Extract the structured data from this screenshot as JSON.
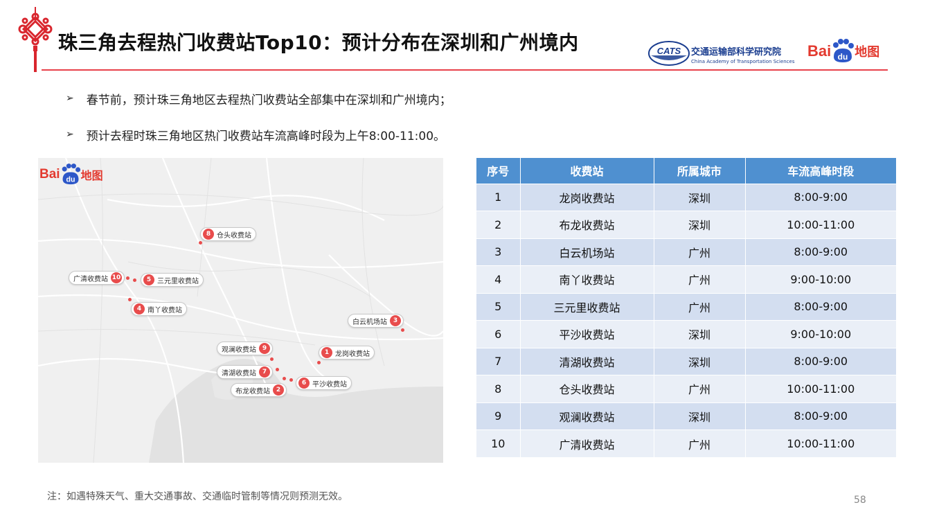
{
  "header": {
    "title": "珠三角去程热门收费站Top10：预计分布在深圳和广州境内",
    "cats_logo_text": "CATS",
    "cats_name_cn": "交通运输部科学研究院",
    "cats_name_en": "China Academy of Transportation Sciences",
    "baidu_bai": "Bai",
    "baidu_du": "du",
    "baidu_ditu": "地图"
  },
  "colors": {
    "accent_red": "#e8414b",
    "table_header": "#4f90d0",
    "row_dark": "#d3def0",
    "row_light": "#eaeff7",
    "marker_red": "#e84c4c"
  },
  "bullets": [
    {
      "icon": "arrow-bullet-icon",
      "text": "春节前，预计珠三角地区去程热门收费站全部集中在深圳和广州境内；"
    },
    {
      "icon": "arrow-bullet-icon",
      "text": "预计去程时珠三角地区热门收费站车流高峰时段为上午8:00-11:00。"
    }
  ],
  "map": {
    "baidu_bai": "Bai",
    "baidu_du": "du",
    "baidu_ditu": "地图",
    "markers": [
      {
        "rank": "8",
        "name": "仓头收费站"
      },
      {
        "rank": "10",
        "name": "广清收费站"
      },
      {
        "rank": "5",
        "name": "三元里收费站"
      },
      {
        "rank": "4",
        "name": "南丫收费站"
      },
      {
        "rank": "3",
        "name": "白云机场站"
      },
      {
        "rank": "9",
        "name": "观澜收费站"
      },
      {
        "rank": "1",
        "name": "龙岗收费站"
      },
      {
        "rank": "7",
        "name": "清湖收费站"
      },
      {
        "rank": "6",
        "name": "平沙收费站"
      },
      {
        "rank": "2",
        "name": "布龙收费站"
      }
    ]
  },
  "table": {
    "headers": [
      "序号",
      "收费站",
      "所属城市",
      "车流高峰时段"
    ],
    "rows": [
      [
        "1",
        "龙岗收费站",
        "深圳",
        "8:00-9:00"
      ],
      [
        "2",
        "布龙收费站",
        "深圳",
        "10:00-11:00"
      ],
      [
        "3",
        "白云机场站",
        "广州",
        "8:00-9:00"
      ],
      [
        "4",
        "南丫收费站",
        "广州",
        "9:00-10:00"
      ],
      [
        "5",
        "三元里收费站",
        "广州",
        "8:00-9:00"
      ],
      [
        "6",
        "平沙收费站",
        "深圳",
        "9:00-10:00"
      ],
      [
        "7",
        "清湖收费站",
        "深圳",
        "8:00-9:00"
      ],
      [
        "8",
        "仓头收费站",
        "广州",
        "10:00-11:00"
      ],
      [
        "9",
        "观澜收费站",
        "深圳",
        "8:00-9:00"
      ],
      [
        "10",
        "广清收费站",
        "广州",
        "10:00-11:00"
      ]
    ]
  },
  "note": "注：如遇特殊天气、重大交通事故、交通临时管制等情况则预测无效。",
  "page_number": "58"
}
